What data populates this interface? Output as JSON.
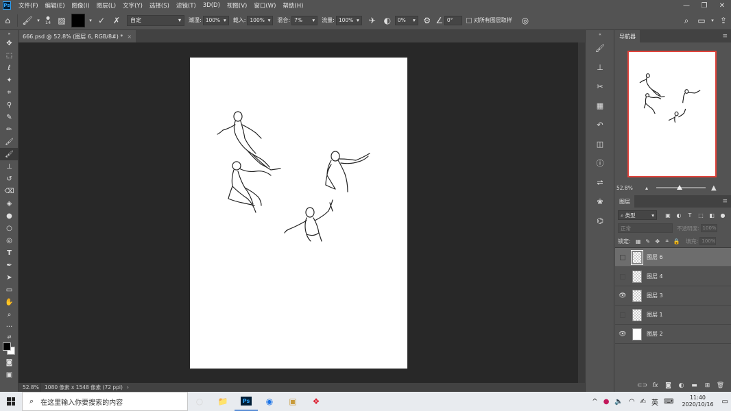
{
  "menu": {
    "items": [
      "文件(F)",
      "编辑(E)",
      "图像(I)",
      "图层(L)",
      "文字(Y)",
      "选择(S)",
      "滤镜(T)",
      "3D(D)",
      "视图(V)",
      "窗口(W)",
      "帮助(H)"
    ],
    "app_logo": "Ps"
  },
  "options": {
    "brush_size": "14",
    "mode_preset": "自定",
    "wet_label": "潮湿:",
    "wet_value": "100%",
    "load_label": "载入:",
    "load_value": "100%",
    "mix_label": "混合:",
    "mix_value": "7%",
    "flow_label": "流量:",
    "flow_value": "100%",
    "smooth_value": "0%",
    "angle_value": "0°",
    "sample_all_label": "对所有图层取样",
    "foreground_color": "#000000"
  },
  "document": {
    "tab_title": "666.psd @ 52.8% (图层 6, RGB/8#) *",
    "zoom": "52.8%",
    "info": "1080 像素 x 1548 像素 (72 ppi)"
  },
  "navigator": {
    "title": "导航器",
    "zoom": "52.8%"
  },
  "layers": {
    "title": "图层",
    "kind_label": "类型",
    "blend_mode": "正常",
    "opacity_label": "不透明度:",
    "opacity_value": "100%",
    "lock_label": "锁定:",
    "fill_label": "填充:",
    "fill_value": "100%",
    "items": [
      {
        "name": "图层 6",
        "visible": false,
        "selected": true
      },
      {
        "name": "图层 4",
        "visible": false,
        "selected": false
      },
      {
        "name": "图层 3",
        "visible": true,
        "selected": false
      },
      {
        "name": "图层 1",
        "visible": false,
        "selected": false
      },
      {
        "name": "图层 2",
        "visible": true,
        "selected": false
      }
    ]
  },
  "taskbar": {
    "search_placeholder": "在这里输入你要搜索的内容",
    "ime_label": "英",
    "time": "11:40",
    "date": "2020/10/16"
  }
}
